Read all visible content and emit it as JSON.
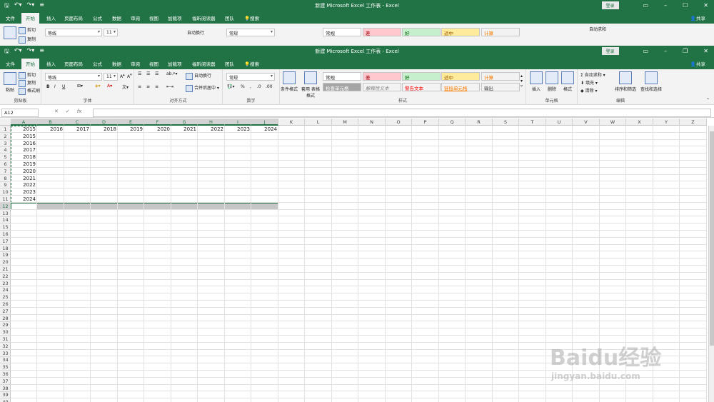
{
  "window_title": "新建 Microsoft Excel 工作表 - Excel",
  "login_label": "登录",
  "share_label": "共享",
  "tabs": [
    "文件",
    "开始",
    "插入",
    "页面布局",
    "公式",
    "数据",
    "审阅",
    "视图",
    "加载项",
    "福昕阅读器",
    "团队"
  ],
  "active_tab": "开始",
  "search_label": "搜索",
  "clipboard": {
    "paste": "粘贴",
    "cut": "剪切",
    "copy": "复制",
    "format_painter": "格式刷",
    "group": "剪贴板"
  },
  "font": {
    "name": "等线",
    "size": "11",
    "group": "字体",
    "bold": "B",
    "italic": "I",
    "underline": "U"
  },
  "alignment": {
    "wrap": "自动换行",
    "merge": "合并后居中",
    "group": "对齐方式"
  },
  "number": {
    "format": "常规",
    "percent": "%",
    "group": "数字"
  },
  "styles": {
    "conditional": "条件格式",
    "table": "套用\n表格格式",
    "group": "样式",
    "cells": [
      {
        "label": "常规",
        "bg": "#ffffff",
        "color": "#222222"
      },
      {
        "label": "差",
        "bg": "#ffc7ce",
        "color": "#9c0006"
      },
      {
        "label": "好",
        "bg": "#c6efce",
        "color": "#006100"
      },
      {
        "label": "适中",
        "bg": "#ffeb9c",
        "color": "#9c5700"
      },
      {
        "label": "计算",
        "bg": "#f2f2f2",
        "color": "#fa7d00"
      },
      {
        "label": "检查单元格",
        "bg": "#a5a5a5",
        "color": "#ffffff"
      },
      {
        "label": "解释性文本",
        "bg": "#f3f3f3",
        "color": "#7f7f7f"
      },
      {
        "label": "警告文本",
        "bg": "#f3f3f3",
        "color": "#ff0000"
      },
      {
        "label": "链接单元格",
        "bg": "#f3f3f3",
        "color": "#fa7d00"
      },
      {
        "label": "输出",
        "bg": "#f2f2f2",
        "color": "#3f3f3f"
      }
    ]
  },
  "cells_group": {
    "insert": "插入",
    "delete": "删除",
    "format": "格式",
    "group": "单元格"
  },
  "editing": {
    "autosum": "自动求和",
    "fill": "填充",
    "clear": "清除",
    "sort": "排序和筛选",
    "find": "查找和选择",
    "group": "编辑"
  },
  "name_box": "A12",
  "fx": "fx",
  "columns": [
    "A",
    "B",
    "C",
    "D",
    "E",
    "F",
    "G",
    "H",
    "I",
    "J",
    "K",
    "L",
    "M",
    "N",
    "O",
    "P",
    "Q",
    "R",
    "S",
    "T",
    "U",
    "V",
    "W",
    "X",
    "Y",
    "Z"
  ],
  "rows": [
    "1",
    "2",
    "3",
    "4",
    "5",
    "6",
    "7",
    "8",
    "9",
    "10",
    "11",
    "12",
    "13",
    "14",
    "15",
    "16",
    "17",
    "18",
    "19",
    "20",
    "21",
    "22",
    "23",
    "24",
    "25",
    "26",
    "27",
    "28",
    "29",
    "30",
    "31",
    "32",
    "33",
    "34",
    "35",
    "36",
    "37",
    "38",
    "39",
    "40"
  ],
  "row1": [
    "2015",
    "2016",
    "2017",
    "2018",
    "2019",
    "2020",
    "2021",
    "2022",
    "2023",
    "2024"
  ],
  "colA": [
    "2015",
    "2016",
    "2017",
    "2018",
    "2019",
    "2020",
    "2021",
    "2022",
    "2023",
    "2024"
  ],
  "selected_row": "12",
  "watermark": {
    "brand": "Baidu经验",
    "url": "jingyan.baidu.com"
  }
}
